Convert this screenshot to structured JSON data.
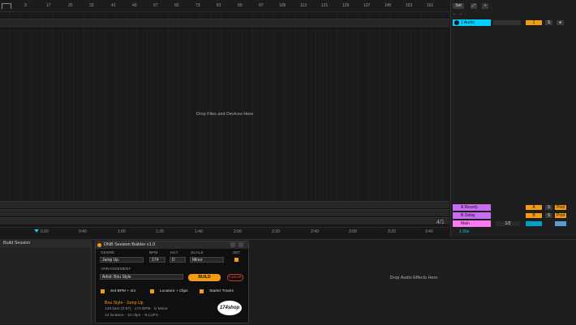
{
  "ruler": {
    "ticks": [
      "9",
      "17",
      "25",
      "33",
      "41",
      "49",
      "57",
      "65",
      "73",
      "81",
      "89",
      "97",
      "105",
      "113",
      "121",
      "129",
      "137",
      "145",
      "153",
      "161"
    ]
  },
  "timeline": {
    "ticks": [
      "0:20",
      "0:40",
      "1:00",
      "1:20",
      "1:40",
      "2:00",
      "2:20",
      "2:40",
      "3:00",
      "3:20",
      "3:40"
    ]
  },
  "arrangement": {
    "drop_hint": "Drop Files and Devices Here"
  },
  "top_right": {
    "set_label": "Set"
  },
  "tracks": [
    {
      "name": "1 Audio",
      "color": "#00d1ff",
      "number": "1"
    }
  ],
  "returns": [
    {
      "name": "A Reverb",
      "color": "#c86cf0",
      "letter": "A",
      "mode": "Post"
    },
    {
      "name": "B Delay",
      "color": "#c86cf0",
      "letter": "B",
      "mode": "Post"
    },
    {
      "name": "Main",
      "color": "#ff7af0",
      "fraction": "1/3"
    }
  ],
  "bar_counter": "4/1",
  "zoom": "1.00x",
  "build_session": {
    "title": "Build Session"
  },
  "device": {
    "title": "DNB Session Builder v1.0",
    "genre_label": "GENRE",
    "genre_value": "Jump Up",
    "bpm_label": "BPM",
    "bpm_value": "174",
    "key_label": "KEY",
    "key_value": "D",
    "scale_label": "SCALE",
    "scale_value": "Minor",
    "set_label": "SET",
    "arrangement_label": "ARRANGEMENT",
    "arrangement_value": "Artist: Bou Style",
    "build_button": "BUILD",
    "clear_button": "CLEAR",
    "option1": "Set BPM + 4/4",
    "option2": "Locators + Clips",
    "option3": "Starter Tracks",
    "summary_title": "Bou Style - Jump Up",
    "summary_line1": "128 bars (2:57) · 174 BPM · D Minor",
    "summary_line2": "13 locators · 10 clips · -8 LUFS",
    "logo": "174shop",
    "accent": "#f39c12"
  },
  "effects": {
    "drop_hint": "Drop Audio Effects Here"
  }
}
